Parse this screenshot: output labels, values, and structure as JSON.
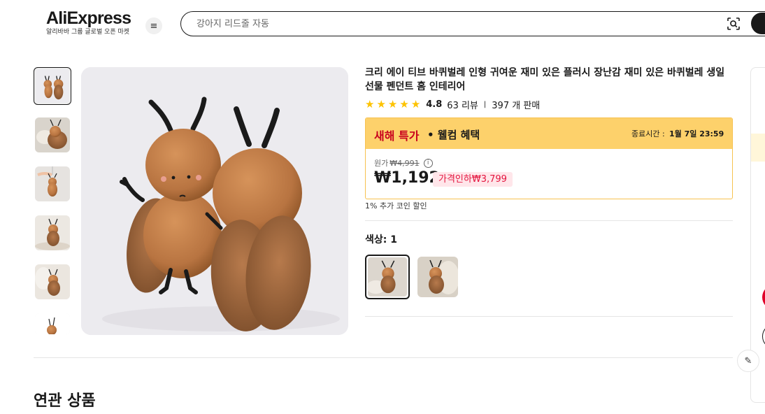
{
  "header": {
    "logo": "AliExpress",
    "logo_tagline": "알리바바 그룹 글로벌 오픈 마켓",
    "menu_icon": "menu-icon",
    "search_placeholder": "강아지 리드줄 자동",
    "camera_icon": "image-search-icon"
  },
  "gallery": {
    "thumbnails": [
      "thumbnail-1",
      "thumbnail-2",
      "thumbnail-3",
      "thumbnail-4",
      "thumbnail-5",
      "thumbnail-6"
    ],
    "selected_index": 0
  },
  "product": {
    "title": "크리 에이 티브 바퀴벌레 인형 귀여운 재미 있은 플러시 장난감 재미 있은 바퀴벌레 생일 선물 펜던트 홈 인테리어",
    "rating": {
      "stars": 5,
      "star_glyph": "★",
      "score": "4.8",
      "reviews": "63 리뷰",
      "separator": "|",
      "sold": "397 개 판매"
    },
    "promo": {
      "name": "새해 특가",
      "subtitle": "• 웰컴 혜택",
      "end_label": "종료시간 :",
      "end_time": "1월 7일 23:59",
      "original_label": "원가",
      "original_price": "₩4,991",
      "info_glyph": "i",
      "price": "₩1,192",
      "discount": "가격인하₩3,799"
    },
    "coin_note": "1% 추가 코인 할인",
    "color_label": "색상: 1",
    "color_options": [
      "color-option-1",
      "color-option-2"
    ]
  },
  "related": {
    "title": "연관 상품"
  },
  "colors": {
    "accent_red": "#c8001d",
    "promo_yellow": "#fdd16b",
    "star_yellow": "#fdc300",
    "discount_pink": "#ffe6ea",
    "discount_text": "#e4143e"
  }
}
